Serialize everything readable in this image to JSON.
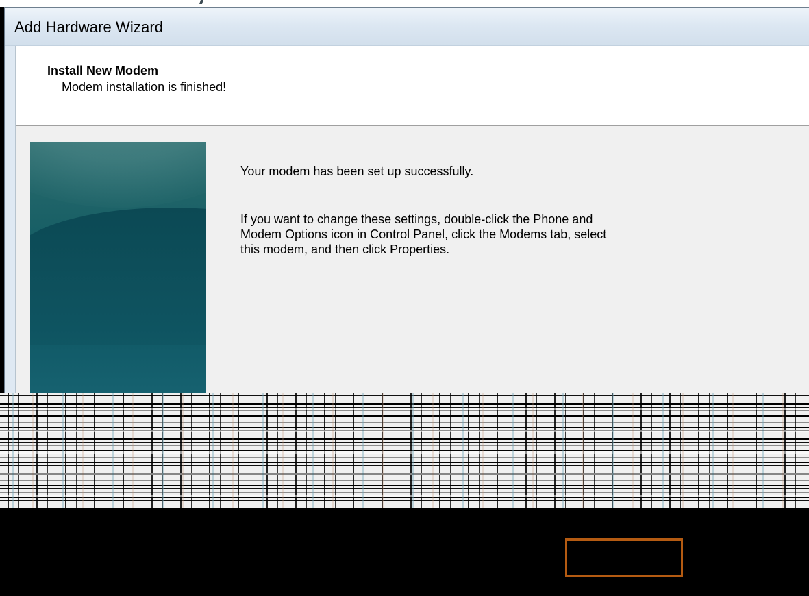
{
  "window": {
    "title": "Add Hardware Wizard"
  },
  "header": {
    "title": "Install New Modem",
    "subtitle": "Modem installation is finished!"
  },
  "content": {
    "primary_message": "Your modem has been set up successfully.",
    "secondary_message": "If you want to change these settings, double-click the Phone and Modem Options icon in Control Panel, click the Modems tab, select this modem, and then click Properties."
  },
  "colors": {
    "title_bar_accent": "#dce7f2",
    "dialog_background": "#f0f0f0",
    "side_graphic_teal": "#155d64",
    "highlight_frame_orange": "#b45b12",
    "glitch_black": "#000000"
  },
  "icons": {
    "side_graphic": "teal-wizard-graphic"
  }
}
